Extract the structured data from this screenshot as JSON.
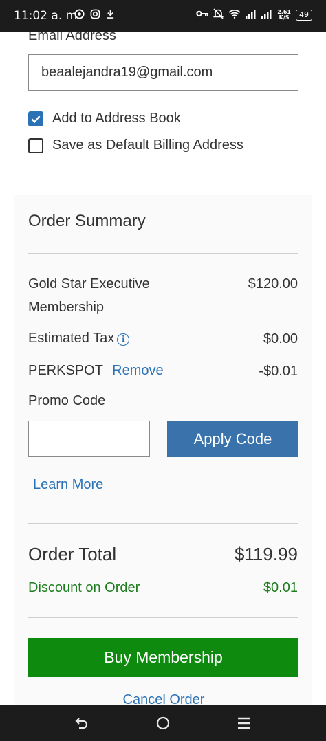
{
  "status_bar": {
    "time": "11:02 a. m.",
    "net_speed_value": "2.61",
    "net_speed_unit": "K/S",
    "battery": "49"
  },
  "billing": {
    "email_label": "Email Address",
    "email_value": "beaalejandra19@gmail.com",
    "add_to_address_book": {
      "label": "Add to Address Book",
      "checked": true
    },
    "save_default_billing": {
      "label": "Save as Default Billing Address",
      "checked": false
    }
  },
  "order_summary": {
    "title": "Order Summary",
    "item_name_line1": "Gold Star Executive",
    "item_name_line2": "Membership",
    "item_price": "$120.00",
    "tax_label": "Estimated Tax",
    "tax_value": "$0.00",
    "promo_code_applied": "PERKSPOT",
    "remove_label": "Remove",
    "promo_discount": "-$0.01",
    "promo_label": "Promo Code",
    "promo_input_value": "",
    "apply_button": "Apply Code",
    "learn_more": "Learn More",
    "total_label": "Order Total",
    "total_value": "$119.99",
    "discount_label": "Discount on Order",
    "discount_value": "$0.01",
    "buy_button": "Buy Membership",
    "cancel_link": "Cancel Order"
  },
  "colors": {
    "link_blue": "#2a72b5",
    "apply_button": "#3a73ac",
    "buy_button": "#0e8a0e",
    "discount_green": "#1e7d1e"
  }
}
